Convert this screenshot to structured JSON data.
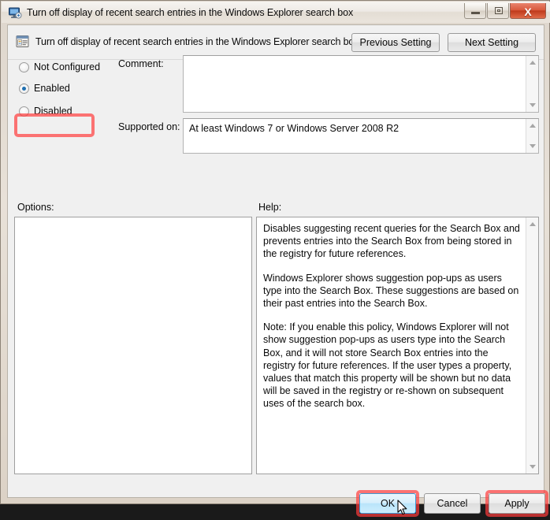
{
  "window": {
    "title": "Turn off display of recent search entries in the Windows Explorer search box",
    "title_icon": "policy-display-icon",
    "controls": {
      "minimize": "minimize-button",
      "restore": "restore-button",
      "close_label": "X"
    }
  },
  "header": {
    "icon": "policy-setting-icon",
    "policy_name": "Turn off display of recent search entries in the Windows Explorer search box",
    "previous_setting_label": "Previous Setting",
    "next_setting_label": "Next Setting"
  },
  "state": {
    "options": [
      {
        "label": "Not Configured",
        "selected": false
      },
      {
        "label": "Enabled",
        "selected": true
      },
      {
        "label": "Disabled",
        "selected": false
      }
    ],
    "selected_value": "Enabled",
    "highlighted": "Enabled"
  },
  "comment": {
    "label": "Comment:",
    "value": "",
    "placeholder": ""
  },
  "supported_on": {
    "label": "Supported on:",
    "value": "At least Windows 7 or Windows Server 2008 R2"
  },
  "options_panel": {
    "label": "Options:",
    "content": ""
  },
  "help_panel": {
    "label": "Help:",
    "paragraphs": [
      "Disables suggesting recent queries for the Search Box and prevents entries into the Search Box from being stored in the registry for future references.",
      "Windows Explorer shows suggestion pop-ups as users type into the Search Box.  These suggestions are based on their past entries into the Search Box.",
      "Note: If you enable this policy, Windows Explorer will not show suggestion pop-ups as users type into the Search Box, and it will not store Search Box entries into the registry for future references.  If the user types a property, values that match this property will be shown but no data will be saved in the registry or re-shown on subsequent uses of the search box."
    ]
  },
  "footer": {
    "ok_label": "OK",
    "cancel_label": "Cancel",
    "apply_label": "Apply",
    "highlighted_buttons": [
      "OK",
      "Apply"
    ],
    "hovered_button": "OK"
  },
  "colors": {
    "highlight_red": "#ff3c3c",
    "accent_blue": "#1f6fb0",
    "close_red": "#bf3a1c",
    "frame_tan": "#ded6cc"
  }
}
